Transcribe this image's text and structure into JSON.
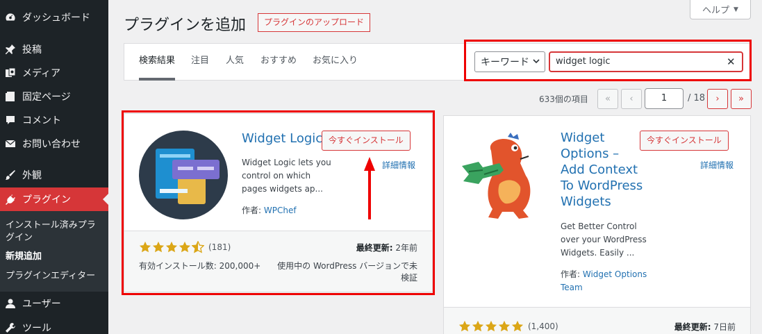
{
  "sidebar": {
    "items": [
      {
        "label": "ダッシュボード",
        "icon": "dashboard-icon"
      },
      {
        "label": "投稿",
        "icon": "pin-icon"
      },
      {
        "label": "メディア",
        "icon": "media-icon"
      },
      {
        "label": "固定ページ",
        "icon": "page-icon"
      },
      {
        "label": "コメント",
        "icon": "comment-icon"
      },
      {
        "label": "お問い合わせ",
        "icon": "mail-icon"
      },
      {
        "label": "外観",
        "icon": "brush-icon"
      },
      {
        "label": "プラグイン",
        "icon": "plugin-icon"
      },
      {
        "label": "ユーザー",
        "icon": "user-icon"
      },
      {
        "label": "ツール",
        "icon": "wrench-icon"
      }
    ],
    "submenu": [
      "インストール済みプラグイン",
      "新規追加",
      "プラグインエディター"
    ]
  },
  "header": {
    "title": "プラグインを追加",
    "upload_label": "プラグインのアップロード",
    "help_label": "ヘルプ"
  },
  "filter": {
    "tabs": [
      "検索結果",
      "注目",
      "人気",
      "おすすめ",
      "お気に入り"
    ],
    "search_type": "キーワード",
    "search_value": "widget logic"
  },
  "pagination": {
    "count": "633個の項目",
    "first": "«",
    "prev": "‹",
    "current": "1",
    "total": "/ 18",
    "next": "›",
    "last": "»"
  },
  "plugins": [
    {
      "name": "Widget Logic",
      "install_label": "今すぐインストール",
      "details_label": "詳細情報",
      "desc_lines": [
        "Widget Logic lets you",
        "control on which",
        "pages widgets ap..."
      ],
      "author_prefix": "作者: ",
      "author": "WPChef",
      "rating_count": "(181)",
      "rating": 4.5,
      "updated_label": "最終更新:",
      "updated_value": "2年前",
      "installs": "有効インストール数: 200,000+",
      "compat_lines": [
        "使用中の WordPress バージョンで未",
        "検証"
      ]
    },
    {
      "name_lines": [
        "Widget",
        "Options –",
        "Add Context",
        "To WordPress",
        "Widgets"
      ],
      "install_label": "今すぐインストール",
      "details_label": "詳細情報",
      "desc_lines": [
        "Get Better Control",
        "over your WordPress",
        "Widgets. Easily ..."
      ],
      "author_prefix": "作者: ",
      "author_lines": [
        "Widget Options",
        "Team"
      ],
      "rating_count": "(1,400)",
      "rating": 5,
      "updated_label": "最終更新:",
      "updated_value": "7日前"
    }
  ],
  "colors": {
    "accent": "#d63638",
    "link": "#2271b1",
    "sidebar": "#1d2327",
    "star": "#dba617",
    "highlight": "#e00000"
  }
}
